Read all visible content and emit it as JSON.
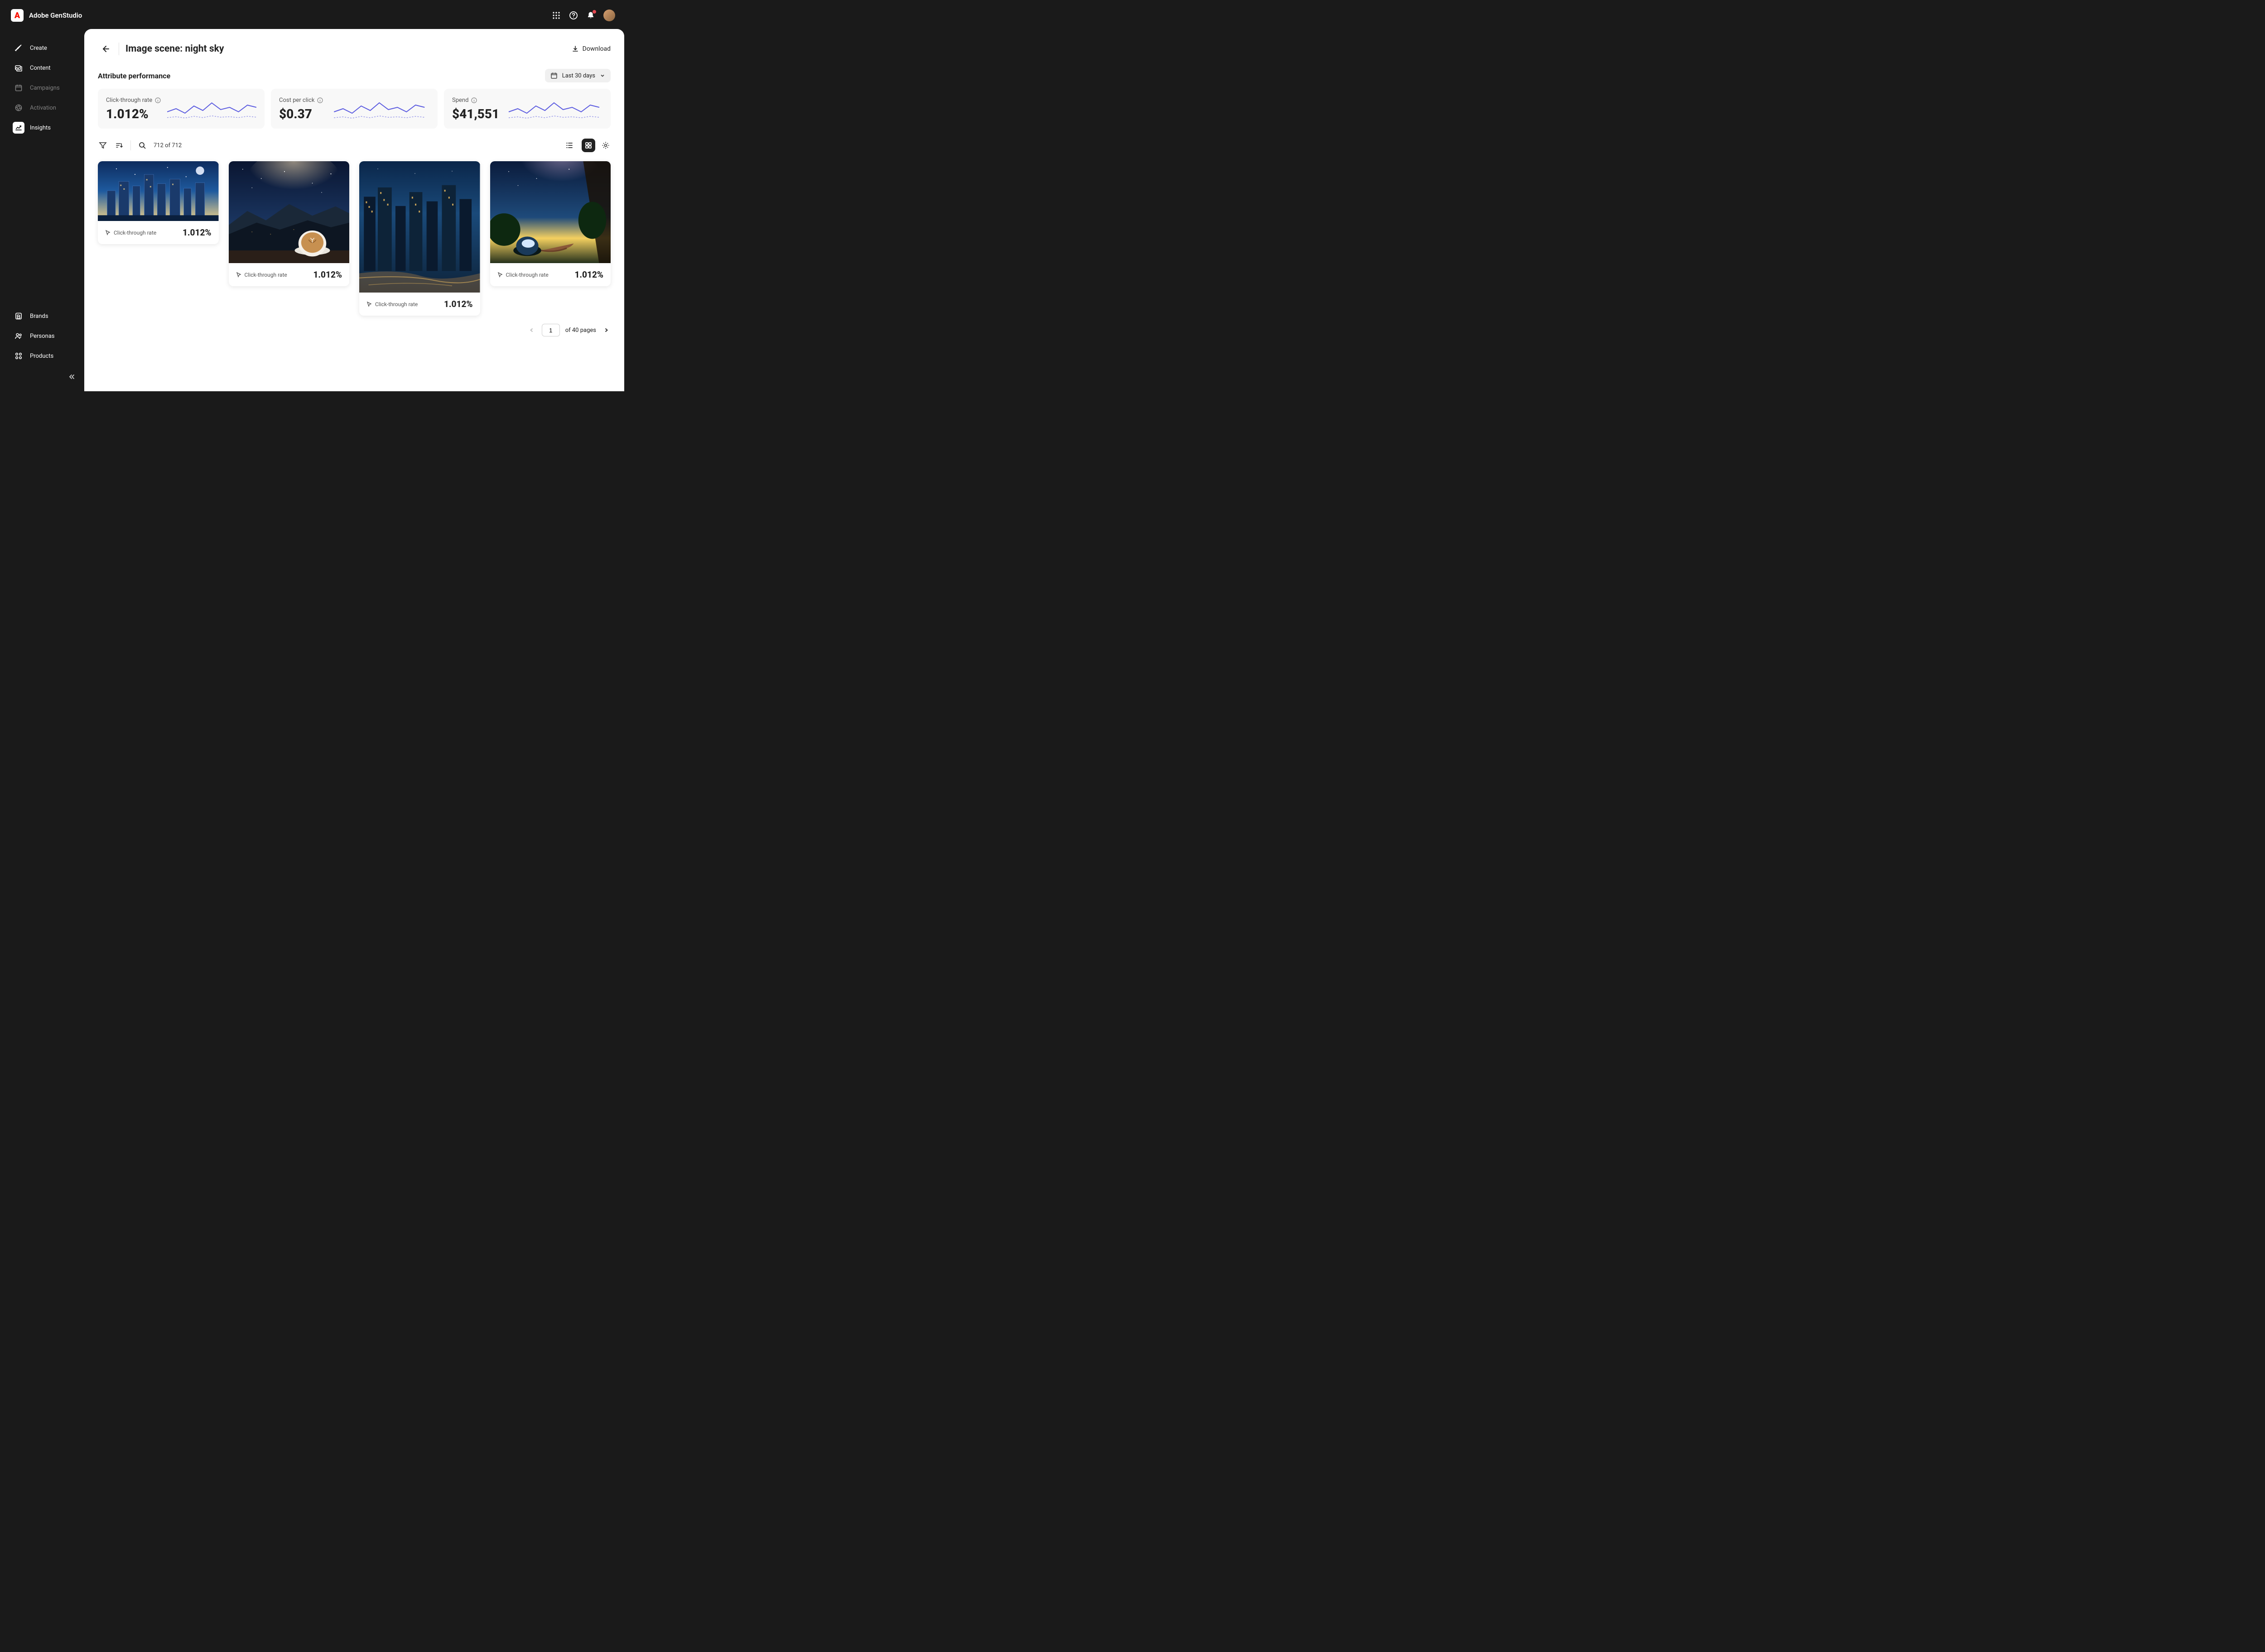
{
  "app": {
    "title": "Adobe GenStudio"
  },
  "sidebar": {
    "top": [
      {
        "label": "Create",
        "icon": "brush",
        "state": "normal"
      },
      {
        "label": "Content",
        "icon": "image-stack",
        "state": "normal"
      },
      {
        "label": "Campaigns",
        "icon": "calendar",
        "state": "disabled"
      },
      {
        "label": "Activation",
        "icon": "aperture",
        "state": "disabled"
      },
      {
        "label": "Insights",
        "icon": "chart",
        "state": "active"
      }
    ],
    "bottom": [
      {
        "label": "Brands",
        "icon": "brand"
      },
      {
        "label": "Personas",
        "icon": "personas"
      },
      {
        "label": "Products",
        "icon": "products"
      }
    ]
  },
  "page": {
    "title": "Image scene: night sky",
    "download_label": "Download",
    "section_title": "Attribute performance",
    "date_range": "Last 30 days"
  },
  "metrics": [
    {
      "label": "Click-through rate",
      "value": "1.012%"
    },
    {
      "label": "Cost per click",
      "value": "$0.37"
    },
    {
      "label": "Spend",
      "value": "$41,551"
    }
  ],
  "toolbar": {
    "result_count": "712 of 712"
  },
  "cards": [
    {
      "metric_label": "Click-through rate",
      "metric_value": "1.012%",
      "thumb_height": 132,
      "palette": "city-illustration"
    },
    {
      "metric_label": "Click-through rate",
      "metric_value": "1.012%",
      "thumb_height": 225,
      "palette": "mountain-coffee"
    },
    {
      "metric_label": "Click-through rate",
      "metric_value": "1.012%",
      "thumb_height": 290,
      "palette": "city-photo"
    },
    {
      "metric_label": "Click-through rate",
      "metric_value": "1.012%",
      "thumb_height": 225,
      "palette": "balcony-coffee"
    }
  ],
  "pagination": {
    "current": "1",
    "total_label": "of 40 pages"
  }
}
